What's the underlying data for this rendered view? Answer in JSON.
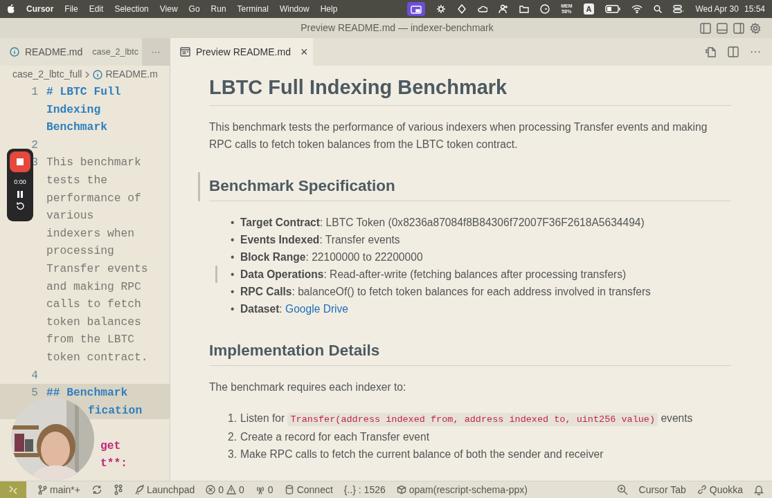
{
  "menu_bar": {
    "app": "Cursor",
    "items": [
      "File",
      "Edit",
      "Selection",
      "View",
      "Go",
      "Run",
      "Terminal",
      "Window",
      "Help"
    ],
    "memory": [
      "MEM",
      "58%"
    ],
    "input_source": "A",
    "date": "Wed Apr 30",
    "time": "15:54"
  },
  "window": {
    "title": "Preview README.md — indexer-benchmark"
  },
  "tabs": [
    {
      "kind": "source",
      "label": "README.md",
      "description": "case_2_lbtc",
      "selected": false
    },
    {
      "kind": "preview",
      "label": "Preview README.md",
      "close": "×",
      "selected": true
    }
  ],
  "tab_overflow": "···",
  "preview_more": "···",
  "breadcrumb": [
    "case_2_lbtc_full",
    "README.m"
  ],
  "editor_lines": [
    {
      "kind": "heading",
      "number": "1",
      "text": "# LBTC Full Indexing Benchmark",
      "current": false
    },
    {
      "kind": "blank",
      "number": "2",
      "current": false
    },
    {
      "kind": "text",
      "number": "3",
      "text": "This benchmark tests the performance of various indexers when processing Transfer events and making RPC calls to fetch token balances from the LBTC token contract.",
      "current": false
    },
    {
      "kind": "blank",
      "number": "4",
      "current": false
    },
    {
      "kind": "heading",
      "number": "5",
      "text": "## Benchmark",
      "current": true
    },
    {
      "kind": "partial-heading",
      "text": "fication",
      "current": true
    },
    {
      "kind": "blank",
      "current": false
    },
    {
      "kind": "partial-bold",
      "text": "get",
      "current": false
    },
    {
      "kind": "partial-bold",
      "text": "t**:",
      "current": false
    }
  ],
  "recorder": {
    "time": "0:00"
  },
  "preview": [
    {
      "kind": "h1",
      "text": "LBTC Full Indexing Benchmark",
      "active": false
    },
    {
      "kind": "p",
      "text": "This benchmark tests the performance of various indexers when processing Transfer events and making RPC calls to fetch token balances from the LBTC token contract.",
      "active": false
    },
    {
      "kind": "h2",
      "text": "Benchmark Specification",
      "active": true
    },
    {
      "kind": "ul",
      "marker": "•",
      "active": false,
      "items": [
        {
          "text": "**Target Contract**: LBTC Token (0x8236a87084f8B84306f72007F36F2618A5634494)",
          "active": false
        },
        {
          "text": "**Events Indexed**: Transfer events",
          "active": false
        },
        {
          "text": "**Block Range**: 22100000 to 22200000",
          "active": false
        },
        {
          "text": "**Data Operations**: Read-after-write (fetching balances after processing transfers)",
          "active": true
        },
        {
          "text": "**RPC Calls**: balanceOf() to fetch token balances for each address involved in transfers",
          "active": false
        },
        {
          "text": "**Dataset**: ",
          "link": "Google Drive",
          "active": false
        }
      ]
    },
    {
      "kind": "h2",
      "text": "Implementation Details",
      "active": false
    },
    {
      "kind": "p",
      "text": "The benchmark requires each indexer to:",
      "active": false
    },
    {
      "kind": "ol",
      "active": false,
      "items": [
        {
          "number": "1.",
          "text": "Listen for ",
          "code": "Transfer(address indexed from, address indexed to, uint256 value)",
          "after": " events",
          "active": false
        },
        {
          "number": "2.",
          "text": "Create a record for each Transfer event",
          "active": false
        },
        {
          "number": "3.",
          "text": "Make RPC calls to fetch the current balance of both the sender and receiver",
          "active": false
        }
      ]
    }
  ],
  "status_bar": {
    "branch": "main*+",
    "launchpad": "Launchpad",
    "errors": "0",
    "warnings": "0",
    "ports": "0",
    "connect": "Connect",
    "symbols": "{..} : 1526",
    "opam": "opam(rescript-schema-ppx)",
    "cursor_tab": "Cursor Tab",
    "quokka": "Quokka"
  }
}
